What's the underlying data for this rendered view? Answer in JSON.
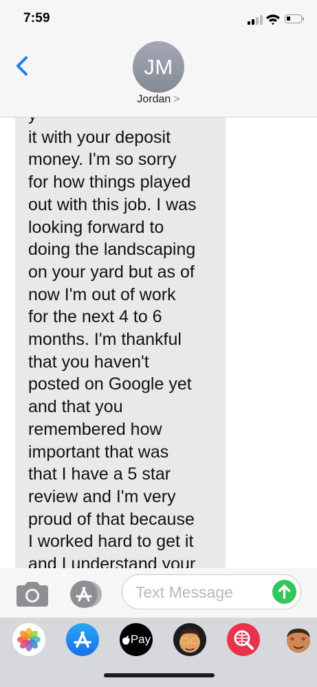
{
  "status_bar": {
    "time": "7:59",
    "signal_bars_active": 2,
    "signal_bars_total": 4,
    "battery_level": 0.3
  },
  "header": {
    "back_icon": "chevron-left-icon",
    "avatar_initials": "JM",
    "contact_name": "Jordan",
    "contact_chevron": ">"
  },
  "conversation": {
    "message_lines": [
      "y",
      "it with your deposit",
      "money. I'm so sorry",
      "for how things played",
      "out with this job. I was",
      "looking forward to",
      "doing the landscaping",
      "on your yard but as of",
      "now I'm out of work",
      "for the next 4 to 6",
      "months. I'm thankful",
      "that you haven't",
      "posted on Google yet",
      "and that you",
      "remembered how",
      "important that was",
      "that I have a 5 star",
      "review and I'm very",
      "proud of that because",
      "I worked hard to get it",
      "and I understand your"
    ]
  },
  "composer": {
    "placeholder": "Text Message",
    "camera_icon": "camera-icon",
    "apps_icon": "app-store-icon",
    "send_icon": "send-arrow-icon"
  },
  "app_drawer": {
    "items": [
      {
        "name": "photos-icon"
      },
      {
        "name": "app-store-icon"
      },
      {
        "name": "apple-pay-icon",
        "label": "Pay"
      },
      {
        "name": "memoji-icon"
      },
      {
        "name": "web-search-icon"
      },
      {
        "name": "animoji-icon"
      }
    ]
  },
  "colors": {
    "accent_blue": "#1a7cf5",
    "bubble_gray": "#e9e9eb",
    "send_green": "#33c759"
  }
}
